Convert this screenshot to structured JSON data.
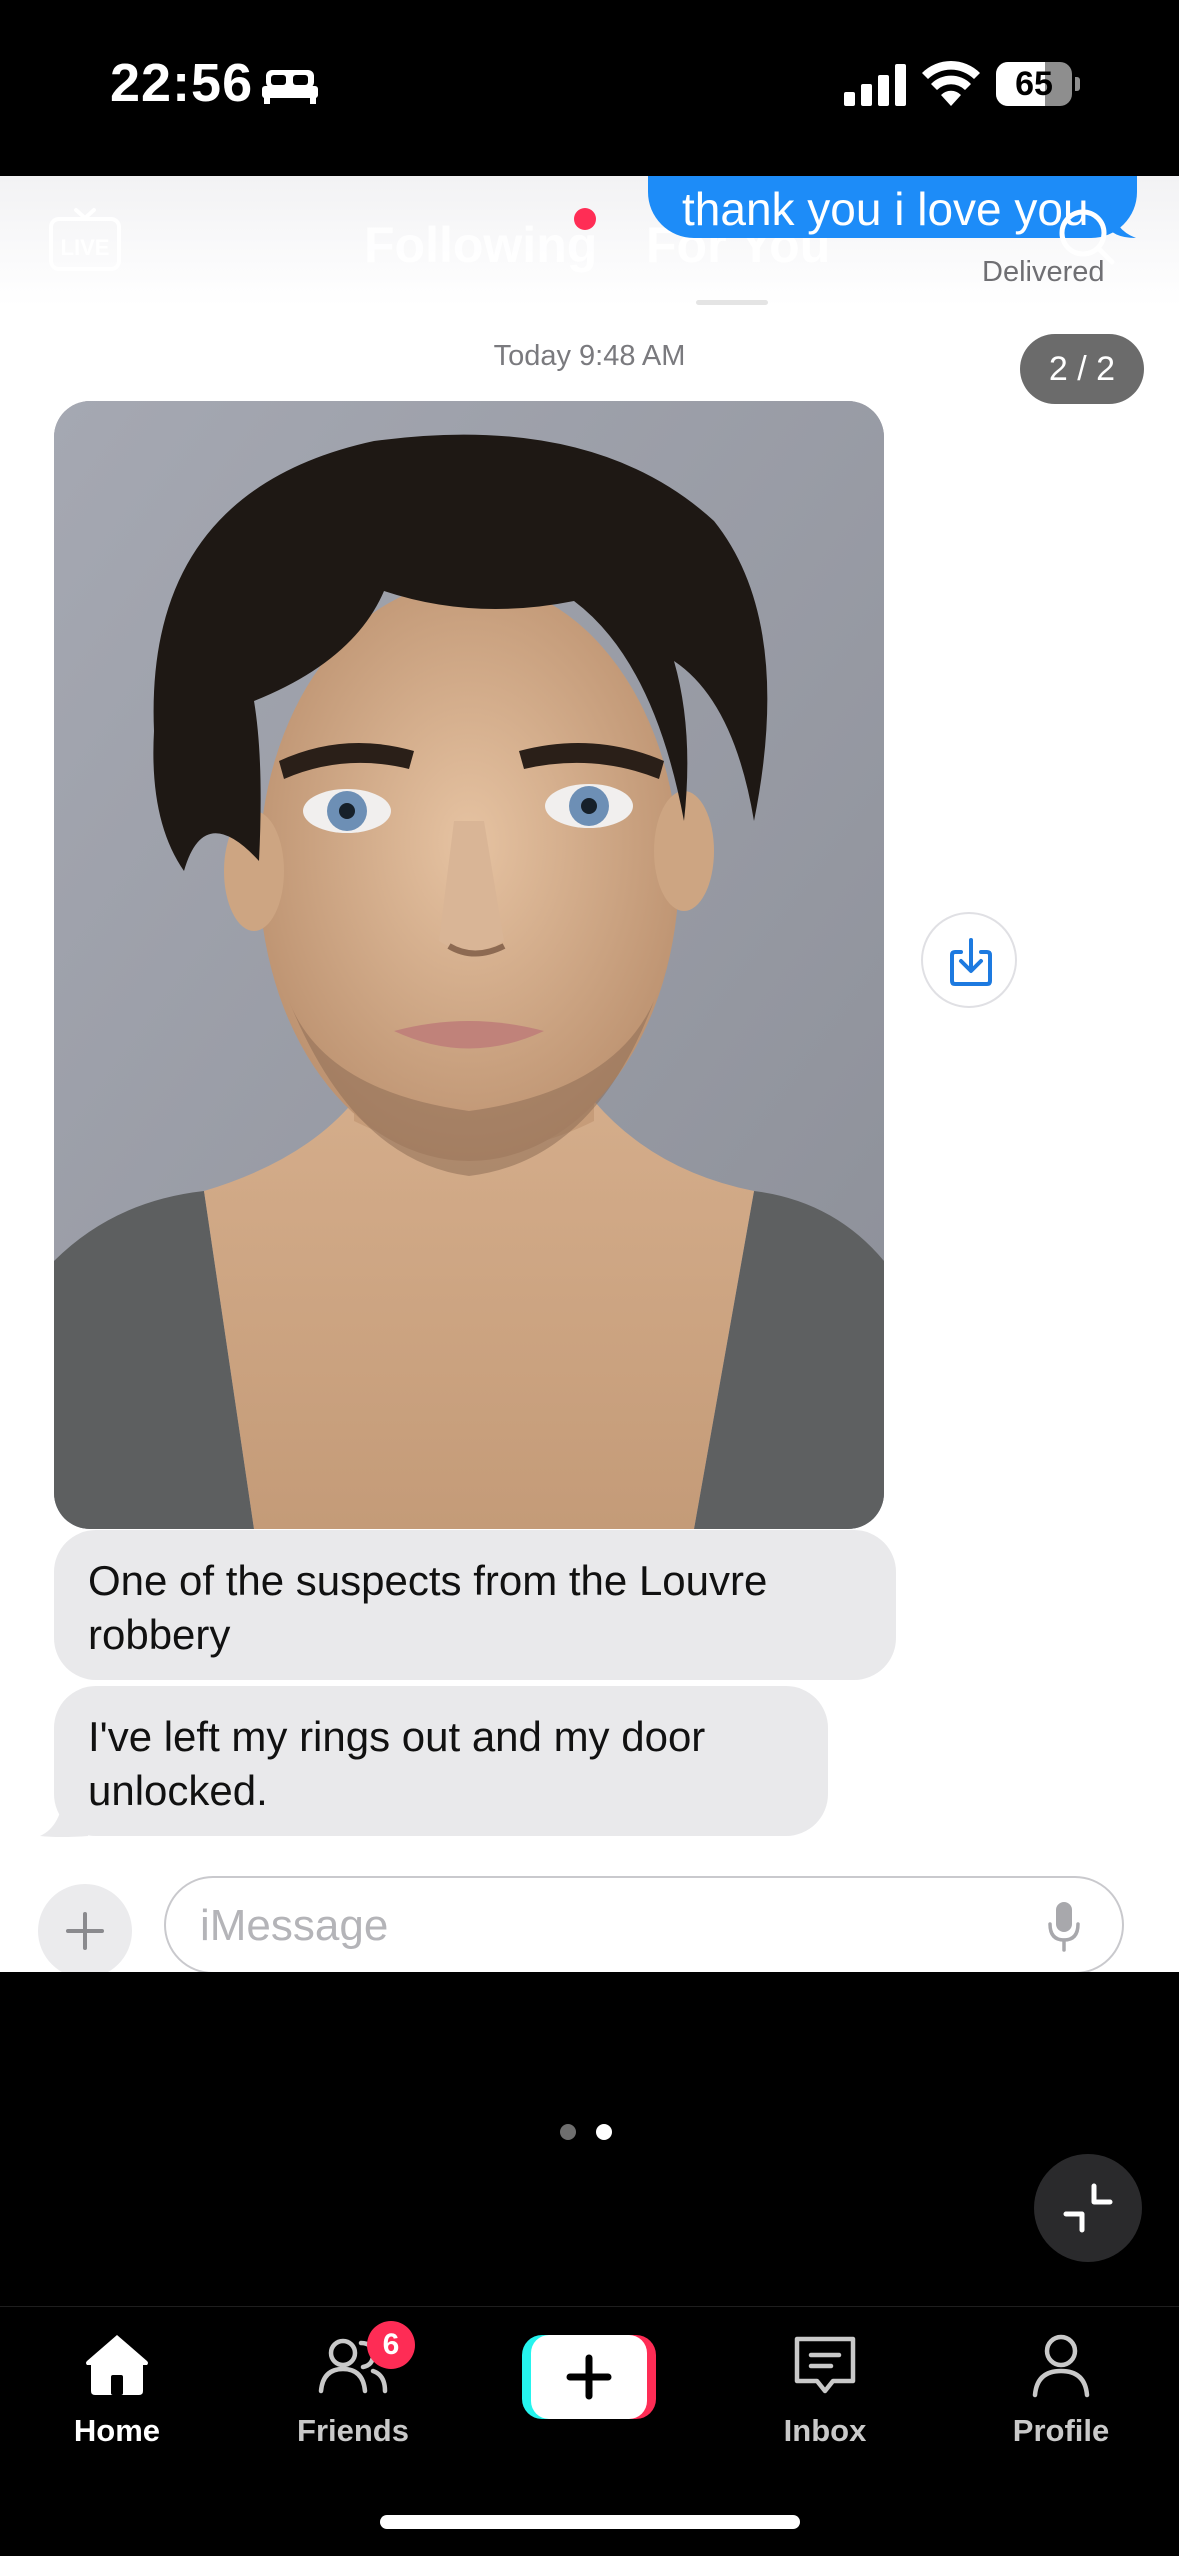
{
  "status_bar": {
    "time": "22:56",
    "battery": "65",
    "battery_level": 0.65
  },
  "tiktok_nav": {
    "live": "LIVE",
    "following": "Following",
    "for_you": "For You"
  },
  "conversation": {
    "sent_message": "thank you i love you",
    "delivered": "Delivered",
    "timestamp": "Today 9:48 AM",
    "page_counter": "2 / 2",
    "received_messages": [
      "One of the suspects from the Louvre robbery",
      "I've left my rings out and my door unlocked."
    ]
  },
  "composer": {
    "placeholder": "iMessage"
  },
  "pager": {
    "count": 2,
    "active": 1
  },
  "tab_bar": {
    "home": "Home",
    "friends": "Friends",
    "friends_badge": "6",
    "inbox": "Inbox",
    "profile": "Profile"
  },
  "colors": {
    "imessage_blue": "#1d8cf8",
    "received_bubble": "#e9e9eb",
    "tiktok_red": "#fe2c55",
    "tiktok_cyan": "#25f4ee"
  }
}
